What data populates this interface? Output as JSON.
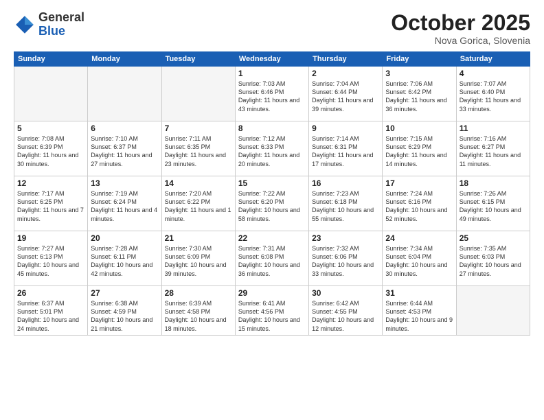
{
  "header": {
    "logo": {
      "general": "General",
      "blue": "Blue"
    },
    "title": "October 2025",
    "location": "Nova Gorica, Slovenia"
  },
  "weekdays": [
    "Sunday",
    "Monday",
    "Tuesday",
    "Wednesday",
    "Thursday",
    "Friday",
    "Saturday"
  ],
  "weeks": [
    [
      {
        "day": "",
        "content": ""
      },
      {
        "day": "",
        "content": ""
      },
      {
        "day": "",
        "content": ""
      },
      {
        "day": "1",
        "content": "Sunrise: 7:03 AM\nSunset: 6:46 PM\nDaylight: 11 hours and 43 minutes."
      },
      {
        "day": "2",
        "content": "Sunrise: 7:04 AM\nSunset: 6:44 PM\nDaylight: 11 hours and 39 minutes."
      },
      {
        "day": "3",
        "content": "Sunrise: 7:06 AM\nSunset: 6:42 PM\nDaylight: 11 hours and 36 minutes."
      },
      {
        "day": "4",
        "content": "Sunrise: 7:07 AM\nSunset: 6:40 PM\nDaylight: 11 hours and 33 minutes."
      }
    ],
    [
      {
        "day": "5",
        "content": "Sunrise: 7:08 AM\nSunset: 6:39 PM\nDaylight: 11 hours and 30 minutes."
      },
      {
        "day": "6",
        "content": "Sunrise: 7:10 AM\nSunset: 6:37 PM\nDaylight: 11 hours and 27 minutes."
      },
      {
        "day": "7",
        "content": "Sunrise: 7:11 AM\nSunset: 6:35 PM\nDaylight: 11 hours and 23 minutes."
      },
      {
        "day": "8",
        "content": "Sunrise: 7:12 AM\nSunset: 6:33 PM\nDaylight: 11 hours and 20 minutes."
      },
      {
        "day": "9",
        "content": "Sunrise: 7:14 AM\nSunset: 6:31 PM\nDaylight: 11 hours and 17 minutes."
      },
      {
        "day": "10",
        "content": "Sunrise: 7:15 AM\nSunset: 6:29 PM\nDaylight: 11 hours and 14 minutes."
      },
      {
        "day": "11",
        "content": "Sunrise: 7:16 AM\nSunset: 6:27 PM\nDaylight: 11 hours and 11 minutes."
      }
    ],
    [
      {
        "day": "12",
        "content": "Sunrise: 7:17 AM\nSunset: 6:25 PM\nDaylight: 11 hours and 7 minutes."
      },
      {
        "day": "13",
        "content": "Sunrise: 7:19 AM\nSunset: 6:24 PM\nDaylight: 11 hours and 4 minutes."
      },
      {
        "day": "14",
        "content": "Sunrise: 7:20 AM\nSunset: 6:22 PM\nDaylight: 11 hours and 1 minute."
      },
      {
        "day": "15",
        "content": "Sunrise: 7:22 AM\nSunset: 6:20 PM\nDaylight: 10 hours and 58 minutes."
      },
      {
        "day": "16",
        "content": "Sunrise: 7:23 AM\nSunset: 6:18 PM\nDaylight: 10 hours and 55 minutes."
      },
      {
        "day": "17",
        "content": "Sunrise: 7:24 AM\nSunset: 6:16 PM\nDaylight: 10 hours and 52 minutes."
      },
      {
        "day": "18",
        "content": "Sunrise: 7:26 AM\nSunset: 6:15 PM\nDaylight: 10 hours and 49 minutes."
      }
    ],
    [
      {
        "day": "19",
        "content": "Sunrise: 7:27 AM\nSunset: 6:13 PM\nDaylight: 10 hours and 45 minutes."
      },
      {
        "day": "20",
        "content": "Sunrise: 7:28 AM\nSunset: 6:11 PM\nDaylight: 10 hours and 42 minutes."
      },
      {
        "day": "21",
        "content": "Sunrise: 7:30 AM\nSunset: 6:09 PM\nDaylight: 10 hours and 39 minutes."
      },
      {
        "day": "22",
        "content": "Sunrise: 7:31 AM\nSunset: 6:08 PM\nDaylight: 10 hours and 36 minutes."
      },
      {
        "day": "23",
        "content": "Sunrise: 7:32 AM\nSunset: 6:06 PM\nDaylight: 10 hours and 33 minutes."
      },
      {
        "day": "24",
        "content": "Sunrise: 7:34 AM\nSunset: 6:04 PM\nDaylight: 10 hours and 30 minutes."
      },
      {
        "day": "25",
        "content": "Sunrise: 7:35 AM\nSunset: 6:03 PM\nDaylight: 10 hours and 27 minutes."
      }
    ],
    [
      {
        "day": "26",
        "content": "Sunrise: 6:37 AM\nSunset: 5:01 PM\nDaylight: 10 hours and 24 minutes."
      },
      {
        "day": "27",
        "content": "Sunrise: 6:38 AM\nSunset: 4:59 PM\nDaylight: 10 hours and 21 minutes."
      },
      {
        "day": "28",
        "content": "Sunrise: 6:39 AM\nSunset: 4:58 PM\nDaylight: 10 hours and 18 minutes."
      },
      {
        "day": "29",
        "content": "Sunrise: 6:41 AM\nSunset: 4:56 PM\nDaylight: 10 hours and 15 minutes."
      },
      {
        "day": "30",
        "content": "Sunrise: 6:42 AM\nSunset: 4:55 PM\nDaylight: 10 hours and 12 minutes."
      },
      {
        "day": "31",
        "content": "Sunrise: 6:44 AM\nSunset: 4:53 PM\nDaylight: 10 hours and 9 minutes."
      },
      {
        "day": "",
        "content": ""
      }
    ]
  ]
}
